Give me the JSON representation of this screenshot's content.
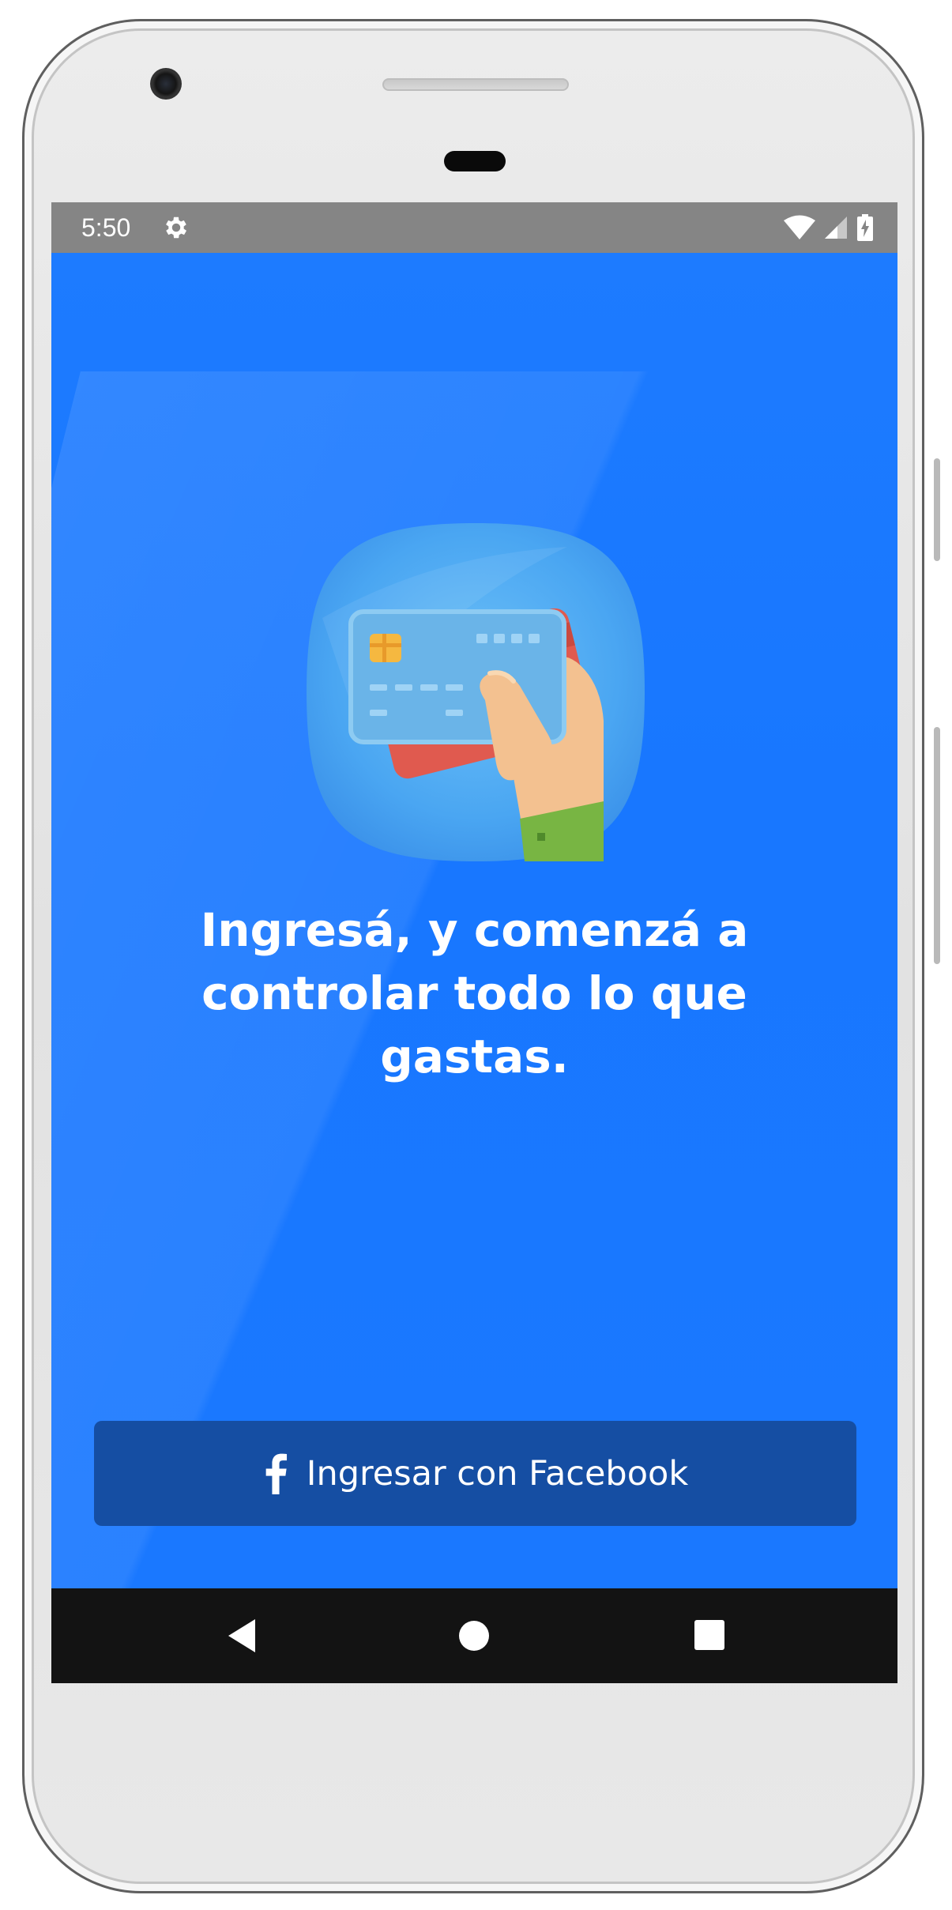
{
  "status_bar": {
    "time": "5:50",
    "settings_icon": "gear-icon",
    "wifi_icon": "wifi-icon",
    "signal_icon": "cell-signal-icon",
    "battery_icon": "battery-charging-icon"
  },
  "main": {
    "illustration": "credit-card-in-hand-icon",
    "headline": "Ingresá, y comenzá a controlar todo lo que gastas.",
    "login_button": {
      "label": "Ingresar con Facebook",
      "icon": "facebook-icon"
    }
  },
  "nav_bar": {
    "back_icon": "back-triangle-icon",
    "home_icon": "home-circle-icon",
    "recents_icon": "recents-square-icon"
  },
  "colors": {
    "app_background": "#1677ff",
    "button_background": "#154ea3",
    "status_bar": "#858585",
    "nav_bar": "#131313"
  }
}
